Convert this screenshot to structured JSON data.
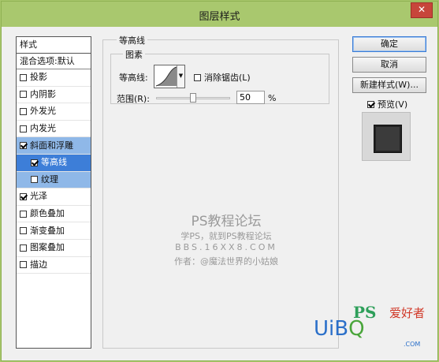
{
  "window": {
    "title": "图层样式",
    "close_label": "✕"
  },
  "sidebar": {
    "header": "样式",
    "blend_options": "混合选项:默认",
    "items": [
      {
        "label": "投影",
        "checked": false,
        "indent": false,
        "state": ""
      },
      {
        "label": "内阴影",
        "checked": false,
        "indent": false,
        "state": ""
      },
      {
        "label": "外发光",
        "checked": false,
        "indent": false,
        "state": ""
      },
      {
        "label": "内发光",
        "checked": false,
        "indent": false,
        "state": ""
      },
      {
        "label": "斜面和浮雕",
        "checked": true,
        "indent": false,
        "state": "active"
      },
      {
        "label": "等高线",
        "checked": true,
        "indent": true,
        "state": "selected"
      },
      {
        "label": "纹理",
        "checked": false,
        "indent": true,
        "state": "active"
      },
      {
        "label": "光泽",
        "checked": true,
        "indent": false,
        "state": ""
      },
      {
        "label": "颜色叠加",
        "checked": false,
        "indent": false,
        "state": ""
      },
      {
        "label": "渐变叠加",
        "checked": false,
        "indent": false,
        "state": ""
      },
      {
        "label": "图案叠加",
        "checked": false,
        "indent": false,
        "state": ""
      },
      {
        "label": "描边",
        "checked": false,
        "indent": false,
        "state": ""
      }
    ]
  },
  "panel": {
    "group_title": "等高线",
    "subgroup_title": "图素",
    "contour_label": "等高线:",
    "antialias_label": "消除锯齿(L)",
    "antialias_checked": false,
    "range_label": "范围(R):",
    "range_value": "50",
    "range_unit": "%",
    "slider_fraction": 0.5
  },
  "watermark": {
    "line1": "PS教程论坛",
    "line2": "学PS，就到PS教程论坛",
    "line3": "BBS.16XX8.COM",
    "line4": "作者：@魔法世界的小姑娘"
  },
  "buttons": {
    "ok": "确定",
    "cancel": "取消",
    "new_style": "新建样式(W)...",
    "preview_label": "预览(V)",
    "preview_checked": true
  },
  "logos": {
    "ps": "PS",
    "ps_cn": "爱好者",
    "uibq_main": "UiB",
    "uibq_q": "Q",
    "uibq_domain": ".COM"
  },
  "colors": {
    "titlebar": "#a9c86e",
    "selected": "#3d7ed8",
    "active": "#8fb8e8",
    "close": "#c7463b"
  }
}
